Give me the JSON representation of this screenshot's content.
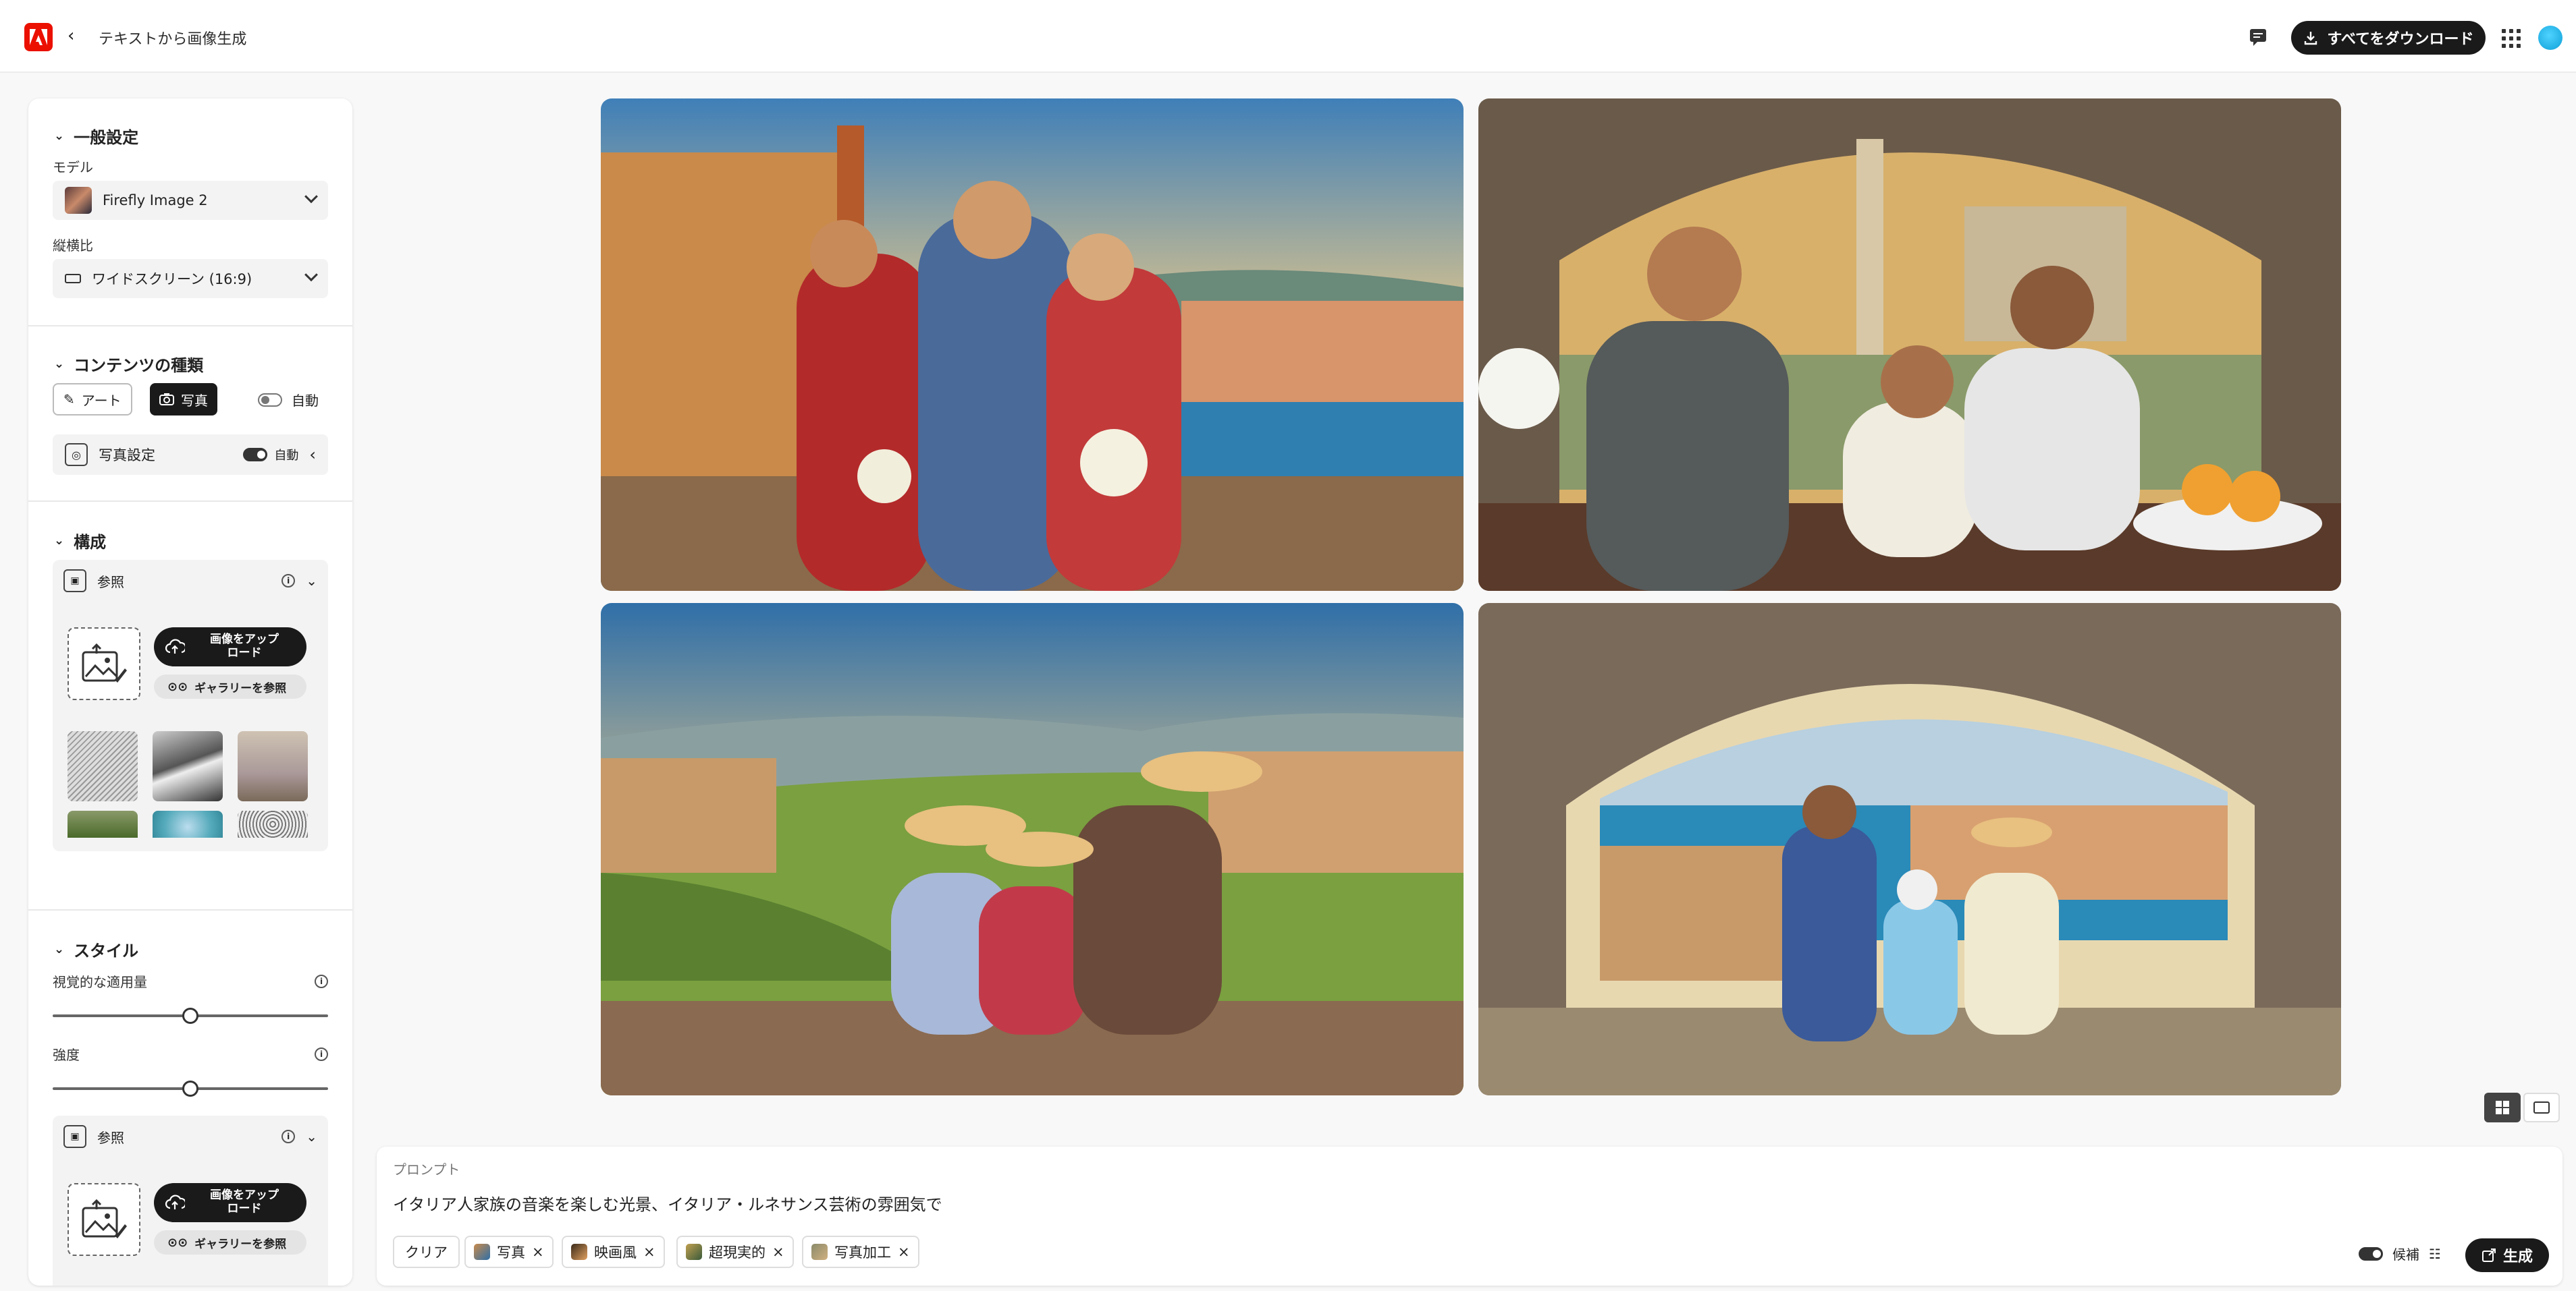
{
  "header": {
    "back_label": "テキストから画像生成",
    "download_all": "すべてをダウンロード"
  },
  "general": {
    "title": "一般設定",
    "model_label": "モデル",
    "model_value": "Firefly Image 2",
    "ratio_label": "縦横比",
    "ratio_value": "ワイドスクリーン (16:9)"
  },
  "content": {
    "title": "コンテンツの種類",
    "art": "アート",
    "photo": "写真",
    "auto": "自動",
    "photo_settings": "写真設定",
    "photo_auto": "自動"
  },
  "composition": {
    "title": "構成",
    "reference": "参照",
    "upload": "画像をアップロード",
    "upload_l1": "画像をアップ",
    "upload_l2": "ロード",
    "gallery": "ギャラリーを参照"
  },
  "style": {
    "title": "スタイル",
    "visual_intensity": "視覚的な適用量",
    "visual_intensity_value": 0.5,
    "strength": "強度",
    "strength_value": 0.5,
    "reference": "参照",
    "upload_l1": "画像をアップ",
    "upload_l2": "ロード",
    "gallery": "ギャラリーを参照"
  },
  "prompt": {
    "label": "プロンプト",
    "text": "イタリア人家族の音楽を楽しむ光景、イタリア・ルネサンス芸術の雰囲気で",
    "clear": "クリア",
    "tags": [
      "写真",
      "映画風",
      "超現実的",
      "写真加工"
    ],
    "suggest": "候補",
    "generate": "生成"
  },
  "colors": {
    "brand": "#eb1000",
    "dark": "#1a1a1a",
    "avatar": "#1ab0e8"
  }
}
